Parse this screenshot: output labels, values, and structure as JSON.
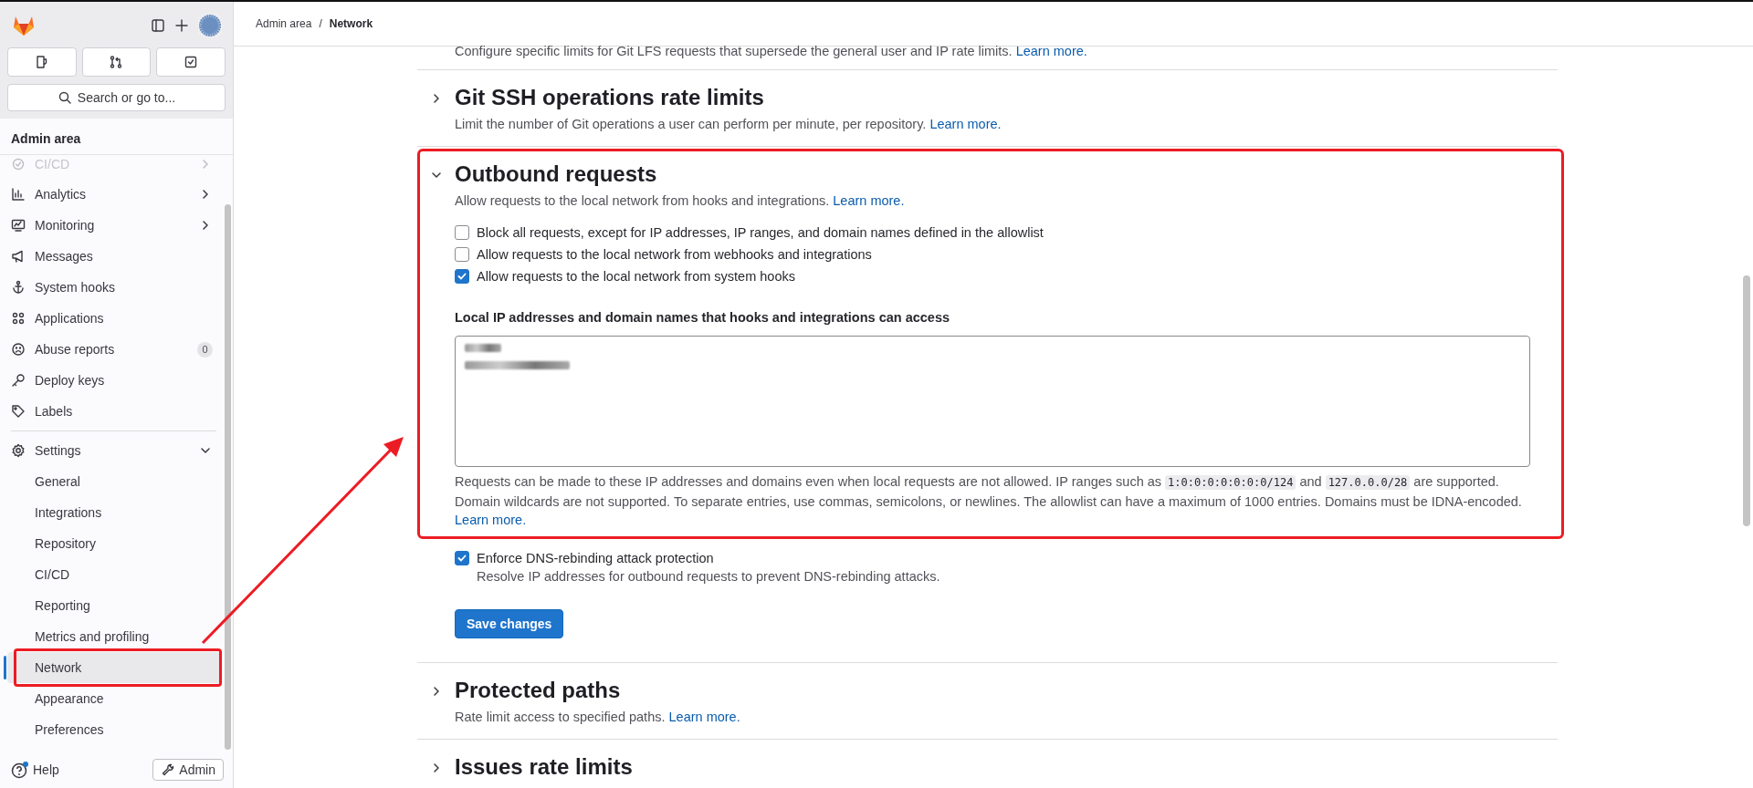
{
  "sidebar": {
    "search_placeholder": "Search or go to...",
    "section_title": "Admin area",
    "items": [
      {
        "label": "CI/CD",
        "kind": "group",
        "expanded": false
      },
      {
        "label": "Analytics",
        "kind": "group",
        "expanded": false
      },
      {
        "label": "Monitoring",
        "kind": "group",
        "expanded": false
      },
      {
        "label": "Messages",
        "kind": "link"
      },
      {
        "label": "System hooks",
        "kind": "link"
      },
      {
        "label": "Applications",
        "kind": "link"
      },
      {
        "label": "Abuse reports",
        "kind": "link",
        "badge": "0"
      },
      {
        "label": "Deploy keys",
        "kind": "link"
      },
      {
        "label": "Labels",
        "kind": "link"
      },
      {
        "label": "Settings",
        "kind": "group",
        "expanded": true,
        "children": [
          {
            "label": "General",
            "selected": false
          },
          {
            "label": "Integrations",
            "selected": false
          },
          {
            "label": "Repository",
            "selected": false
          },
          {
            "label": "CI/CD",
            "selected": false
          },
          {
            "label": "Reporting",
            "selected": false
          },
          {
            "label": "Metrics and profiling",
            "selected": false
          },
          {
            "label": "Network",
            "selected": true
          },
          {
            "label": "Appearance",
            "selected": false
          },
          {
            "label": "Preferences",
            "selected": false
          }
        ]
      }
    ],
    "help": "Help",
    "admin_button": "Admin"
  },
  "breadcrumb": {
    "items": [
      "Admin area",
      "Network"
    ],
    "separator": "/"
  },
  "sections": [
    {
      "kind": "partial",
      "description": "Configure specific limits for Git LFS requests that supersede the general user and IP rate limits.",
      "link": "Learn more."
    },
    {
      "kind": "section",
      "title": "Git SSH operations rate limits",
      "description": "Limit the number of Git operations a user can perform per minute, per repository.",
      "link": "Learn more.",
      "expanded": false
    },
    {
      "kind": "outbound",
      "title": "Outbound requests",
      "description": "Allow requests to the local network from hooks and integrations.",
      "link": "Learn more.",
      "expanded": true
    },
    {
      "kind": "section",
      "title": "Protected paths",
      "description": "Rate limit access to specified paths.",
      "link": "Learn more.",
      "expanded": false
    },
    {
      "kind": "section",
      "title": "Issues rate limits",
      "expanded": false
    }
  ],
  "outbound": {
    "checkboxes": [
      {
        "label": "Block all requests, except for IP addresses, IP ranges, and domain names defined in the allowlist",
        "checked": false
      },
      {
        "label": "Allow requests to the local network from webhooks and integrations",
        "checked": false
      },
      {
        "label": "Allow requests to the local network from system hooks",
        "checked": true
      }
    ],
    "allowlist_label": "Local IP addresses and domain names that hooks and integrations can access",
    "help_parts": [
      {
        "kind": "text",
        "text": "Requests can be made to these IP addresses and domains even when local requests are not allowed. IP ranges such as "
      },
      {
        "kind": "code",
        "text": "1:0:0:0:0:0:0:0/124"
      },
      {
        "kind": "text",
        "text": " and "
      },
      {
        "kind": "code",
        "text": "127.0.0.0/28"
      },
      {
        "kind": "text",
        "text": " are supported. Domain wildcards are not supported. To separate entries, use commas, semicolons, or newlines. The allowlist can have a maximum of 1000 entries. Domains must be IDNA-encoded. "
      },
      {
        "kind": "link",
        "text": "Learn more."
      }
    ],
    "dns": {
      "label": "Enforce DNS-rebinding attack protection",
      "description": "Resolve IP addresses for outbound requests to prevent DNS-rebinding attacks.",
      "checked": true
    },
    "save_button": "Save changes"
  }
}
